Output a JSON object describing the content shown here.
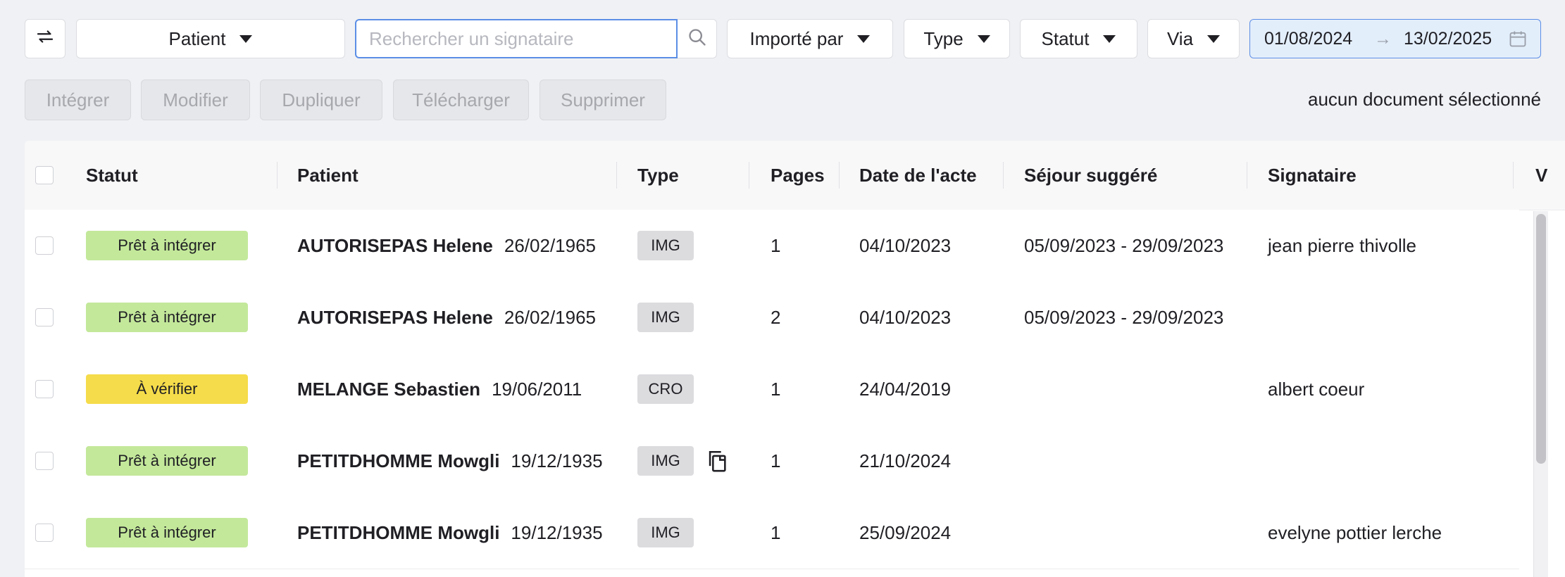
{
  "toolbar": {
    "patient_filter": "Patient",
    "search_placeholder": "Rechercher un signataire",
    "imported_by": "Importé par",
    "type": "Type",
    "statut": "Statut",
    "via": "Via",
    "date_from": "01/08/2024",
    "date_arrow": "→",
    "date_to": "13/02/2025"
  },
  "actions": {
    "integrer": "Intégrer",
    "modifier": "Modifier",
    "dupliquer": "Dupliquer",
    "telecharger": "Télécharger",
    "supprimer": "Supprimer",
    "selection_info": "aucun document sélectionné"
  },
  "table": {
    "headers": {
      "statut": "Statut",
      "patient": "Patient",
      "type": "Type",
      "pages": "Pages",
      "date_acte": "Date de l'acte",
      "sejour": "Séjour suggéré",
      "signataire": "Signataire",
      "via": "V"
    },
    "rows": [
      {
        "status": "Prêt à intégrer",
        "status_color": "#c3e89a",
        "patient": "AUTORISEPAS Helene",
        "dob": "26/02/1965",
        "type": "IMG",
        "pages": "1",
        "date": "04/10/2023",
        "sejour": "05/09/2023 - 29/09/2023",
        "signataire": "jean pierre thivolle"
      },
      {
        "status": "Prêt à intégrer",
        "status_color": "#c3e89a",
        "patient": "AUTORISEPAS Helene",
        "dob": "26/02/1965",
        "type": "IMG",
        "pages": "2",
        "date": "04/10/2023",
        "sejour": "05/09/2023 - 29/09/2023",
        "signataire": ""
      },
      {
        "status": "À vérifier",
        "status_color": "#f5dc4a",
        "patient": "MELANGE Sebastien",
        "dob": "19/06/2011",
        "type": "CRO",
        "pages": "1",
        "date": "24/04/2019",
        "sejour": "",
        "signataire": "albert coeur"
      },
      {
        "status": "Prêt à intégrer",
        "status_color": "#c3e89a",
        "patient": "PETITDHOMME Mowgli",
        "dob": "19/12/1935",
        "type": "IMG",
        "pages": "1",
        "date": "21/10/2024",
        "sejour": "",
        "signataire": ""
      },
      {
        "status": "Prêt à intégrer",
        "status_color": "#c3e89a",
        "patient": "PETITDHOMME Mowgli",
        "dob": "19/12/1935",
        "type": "IMG",
        "pages": "1",
        "date": "25/09/2024",
        "sejour": "",
        "signataire": "evelyne pottier lerche"
      }
    ]
  },
  "icons": {
    "refresh": "refresh-icon",
    "search": "search-icon",
    "calendar": "calendar-icon",
    "copy": "copy-icon"
  },
  "colors": {
    "accent_blue": "#5b8ee6",
    "ready_green": "#c3e89a",
    "verify_yellow": "#f5dc4a"
  }
}
